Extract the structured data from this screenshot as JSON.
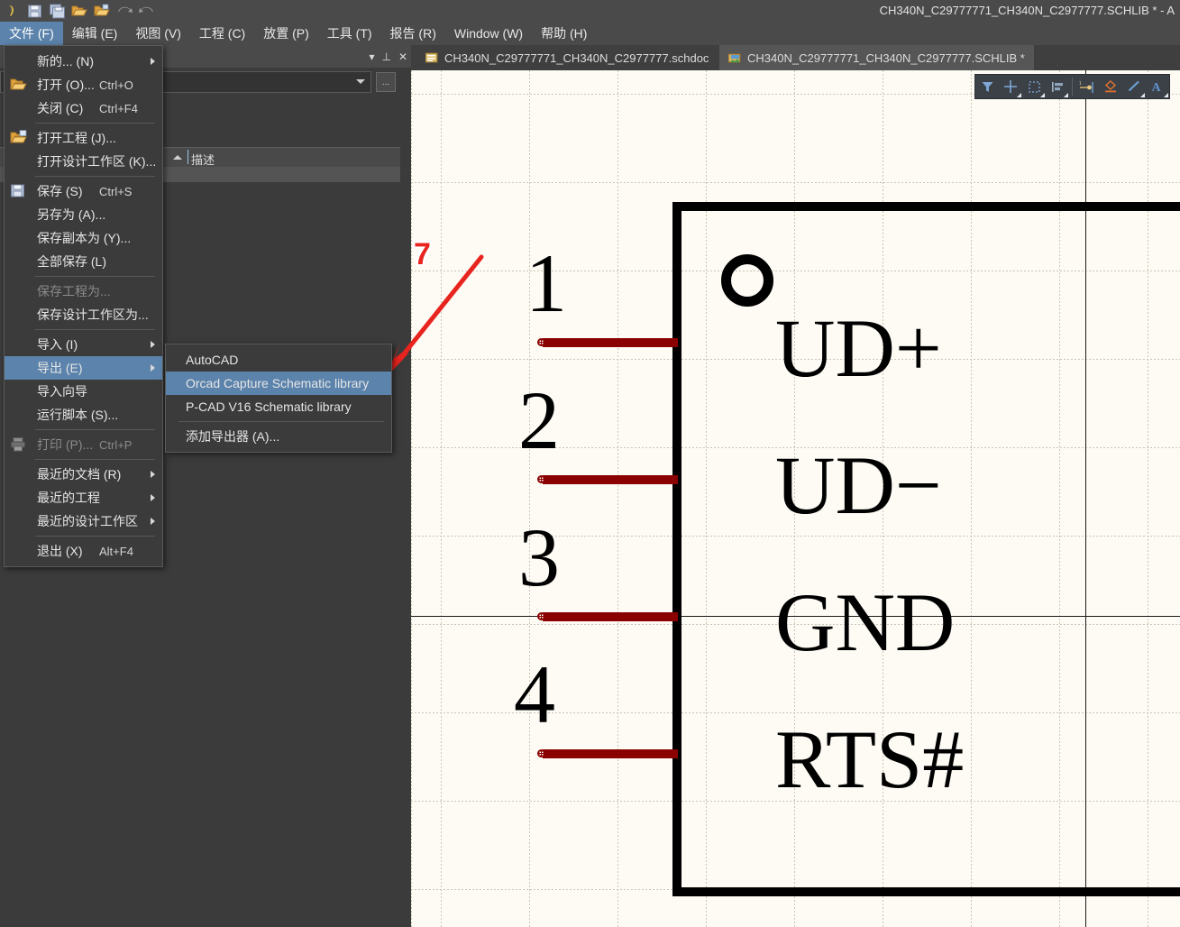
{
  "window": {
    "title": "CH340N_C29777771_CH340N_C2977777.SCHLIB * - A",
    "quick_access": [
      "altium-logo-icon",
      "save-icon",
      "save-all-icon",
      "open-icon",
      "open-project-icon",
      "undo-icon",
      "redo-icon"
    ]
  },
  "menubar": [
    {
      "label": "文件 (F)",
      "active": true
    },
    {
      "label": "编辑 (E)",
      "active": false
    },
    {
      "label": "视图 (V)",
      "active": false
    },
    {
      "label": "工程 (C)",
      "active": false
    },
    {
      "label": "放置 (P)",
      "active": false
    },
    {
      "label": "工具 (T)",
      "active": false
    },
    {
      "label": "报告 (R)",
      "active": false
    },
    {
      "label": "Window (W)",
      "active": false
    },
    {
      "label": "帮助 (H)",
      "active": false
    }
  ],
  "file_menu": {
    "items": [
      {
        "label": "新的... (N)",
        "accel": "",
        "submenu": true,
        "icon": "",
        "disabled": false,
        "selected": false,
        "sep_after": false
      },
      {
        "label": "打开 (O)...",
        "accel": "Ctrl+O",
        "submenu": false,
        "icon": "open-folder-icon",
        "disabled": false,
        "selected": false,
        "sep_after": false
      },
      {
        "label": "关闭 (C)",
        "accel": "Ctrl+F4",
        "submenu": false,
        "icon": "",
        "disabled": false,
        "selected": false,
        "sep_after": true
      },
      {
        "label": "打开工程 (J)...",
        "accel": "",
        "submenu": false,
        "icon": "open-project-icon",
        "disabled": false,
        "selected": false,
        "sep_after": false
      },
      {
        "label": "打开设计工作区 (K)...",
        "accel": "",
        "submenu": false,
        "icon": "",
        "disabled": false,
        "selected": false,
        "sep_after": true
      },
      {
        "label": "保存 (S)",
        "accel": "Ctrl+S",
        "submenu": false,
        "icon": "save-icon",
        "disabled": false,
        "selected": false,
        "sep_after": false
      },
      {
        "label": "另存为 (A)...",
        "accel": "",
        "submenu": false,
        "icon": "",
        "disabled": false,
        "selected": false,
        "sep_after": false
      },
      {
        "label": "保存副本为 (Y)...",
        "accel": "",
        "submenu": false,
        "icon": "",
        "disabled": false,
        "selected": false,
        "sep_after": false
      },
      {
        "label": "全部保存 (L)",
        "accel": "",
        "submenu": false,
        "icon": "",
        "disabled": false,
        "selected": false,
        "sep_after": true
      },
      {
        "label": "保存工程为...",
        "accel": "",
        "submenu": false,
        "icon": "",
        "disabled": true,
        "selected": false,
        "sep_after": false
      },
      {
        "label": "保存设计工作区为...",
        "accel": "",
        "submenu": false,
        "icon": "",
        "disabled": false,
        "selected": false,
        "sep_after": true
      },
      {
        "label": "导入 (I)",
        "accel": "",
        "submenu": true,
        "icon": "",
        "disabled": false,
        "selected": false,
        "sep_after": false
      },
      {
        "label": "导出 (E)",
        "accel": "",
        "submenu": true,
        "icon": "",
        "disabled": false,
        "selected": true,
        "sep_after": false
      },
      {
        "label": "导入向导",
        "accel": "",
        "submenu": false,
        "icon": "",
        "disabled": false,
        "selected": false,
        "sep_after": false
      },
      {
        "label": "运行脚本 (S)...",
        "accel": "",
        "submenu": false,
        "icon": "",
        "disabled": false,
        "selected": false,
        "sep_after": true
      },
      {
        "label": "打印 (P)...",
        "accel": "Ctrl+P",
        "submenu": false,
        "icon": "printer-icon",
        "disabled": true,
        "selected": false,
        "sep_after": true
      },
      {
        "label": "最近的文档 (R)",
        "accel": "",
        "submenu": true,
        "icon": "",
        "disabled": false,
        "selected": false,
        "sep_after": false
      },
      {
        "label": "最近的工程",
        "accel": "",
        "submenu": true,
        "icon": "",
        "disabled": false,
        "selected": false,
        "sep_after": false
      },
      {
        "label": "最近的设计工作区",
        "accel": "",
        "submenu": true,
        "icon": "",
        "disabled": false,
        "selected": false,
        "sep_after": true
      },
      {
        "label": "退出 (X)",
        "accel": "Alt+F4",
        "submenu": false,
        "icon": "",
        "disabled": false,
        "selected": false,
        "sep_after": false
      }
    ]
  },
  "export_submenu": {
    "items": [
      {
        "label": "AutoCAD",
        "selected": false,
        "sep_after": false
      },
      {
        "label": "Orcad Capture Schematic library",
        "selected": true,
        "sep_after": false
      },
      {
        "label": "P-CAD V16 Schematic library",
        "selected": false,
        "sep_after": true
      },
      {
        "label": "添加导出器 (A)...",
        "selected": false,
        "sep_after": false
      }
    ]
  },
  "left_panel": {
    "search_value": "",
    "column_header": "描述",
    "buttons": [
      "dropdown-icon",
      "pin-icon",
      "close-icon"
    ],
    "browse_button": "..."
  },
  "tabs": [
    {
      "label": "CH340N_C29777771_CH340N_C2977777.schdoc",
      "active": false,
      "icon": "schematic-doc-icon"
    },
    {
      "label": "CH340N_C29777771_CH340N_C2977777.SCHLIB *",
      "active": true,
      "icon": "schematic-lib-icon"
    }
  ],
  "canvas_toolbar": {
    "buttons": [
      {
        "name": "filter-icon"
      },
      {
        "name": "move-cross-icon"
      },
      {
        "name": "selection-rect-icon"
      },
      {
        "name": "align-icon"
      },
      {
        "name": "place-pin-icon"
      },
      {
        "name": "place-polygon-icon"
      },
      {
        "name": "place-line-icon"
      },
      {
        "name": "place-text-icon"
      }
    ]
  },
  "schematic": {
    "component_outline_color": "#000000",
    "pin_color": "#8b0000",
    "background_color": "#fdfbf4",
    "pins": [
      {
        "number": "1",
        "name": "UD+"
      },
      {
        "number": "2",
        "name": "UD−"
      },
      {
        "number": "3",
        "name": "GND"
      },
      {
        "number": "4",
        "name": "RTS#"
      }
    ]
  },
  "annotation": {
    "step_number": "7",
    "color": "#e8241f",
    "arrow": "points-to-orcad-capture-schematic-library"
  }
}
